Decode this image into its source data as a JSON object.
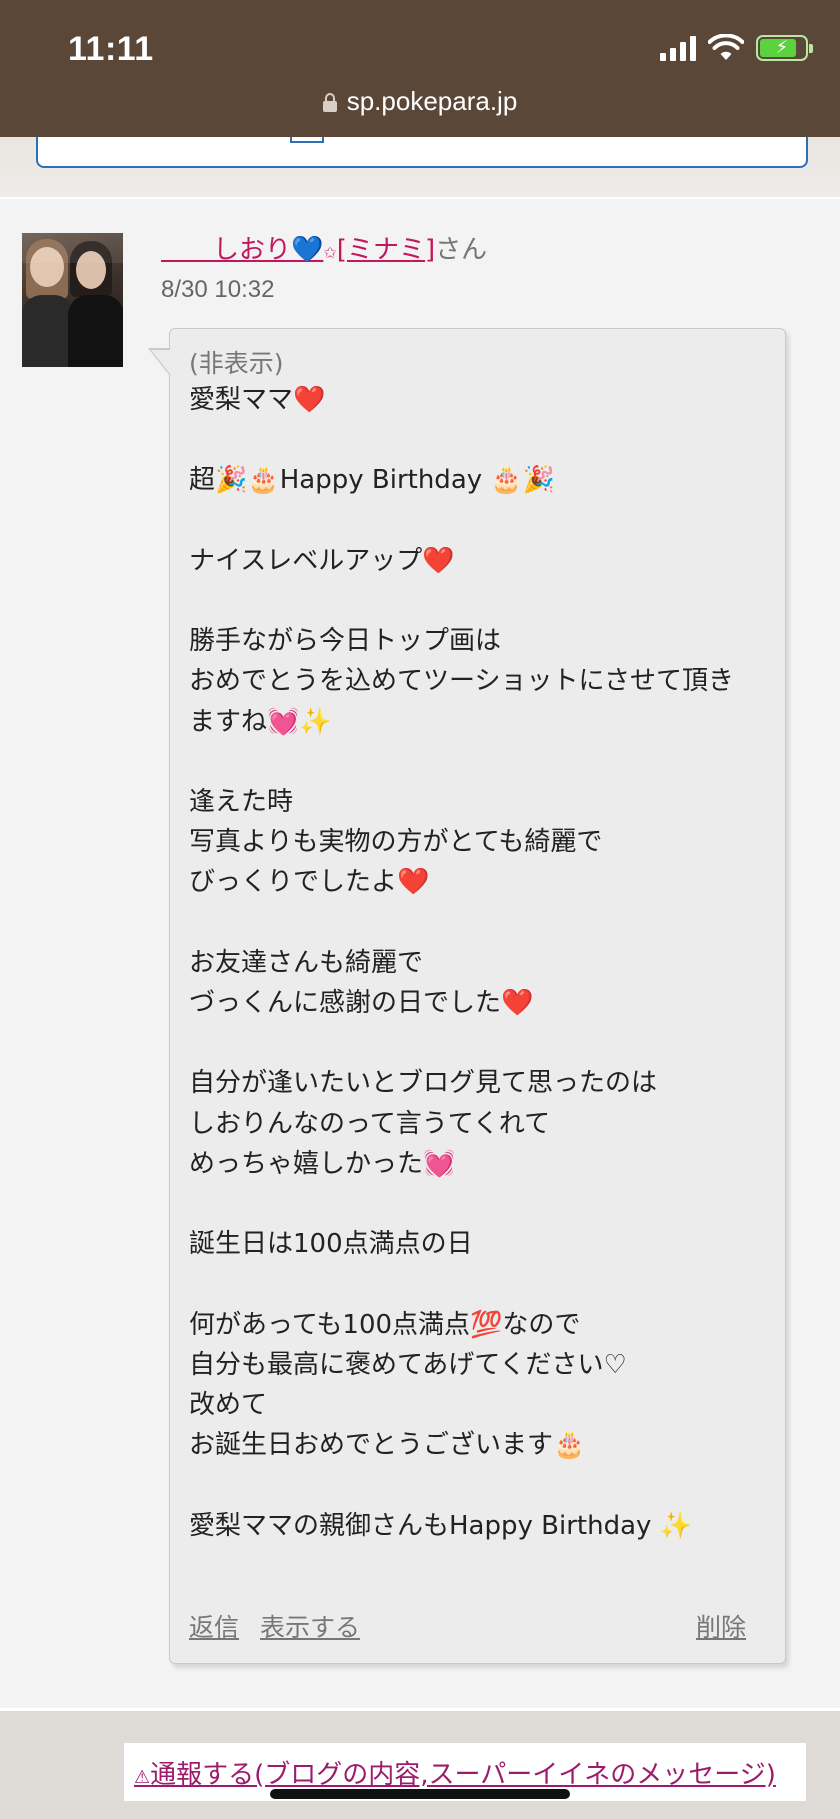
{
  "status_bar": {
    "time": "11:11",
    "url": "sp.pokepara.jp"
  },
  "comment": {
    "author_name": "＿＿しおり",
    "author_tag": "[ミナミ]",
    "author_suffix": "さん",
    "date": "8/30 10:32",
    "hidden_label": "(非表示)",
    "message": "愛梨ママ❤️\n\n超🎉🎂Happy Birthday 🎂🎉\n\nナイスレベルアップ❤️\n\n勝手ながら今日トップ画は\nおめでとうを込めてツーショットにさせて頂き\nますね💓✨\n\n逢えた時\n写真よりも実物の方がとても綺麗で\nびっくりでしたよ❤️\n\nお友達さんも綺麗で\nづっくんに感謝の日でした❤️\n\n自分が逢いたいとブログ見て思ったのは\nしおりんなのって言うてくれて\nめっちゃ嬉しかった💓\n\n誕生日は100点満点の日\n\n何があっても100点満点💯なので\n自分も最高に褒めてあげてください♡\n改めて\nお誕生日おめでとうございます🎂\n\n愛梨ママの親御さんもHappy Birthday ✨",
    "actions": {
      "reply": "返信",
      "show": "表示する",
      "delete": "削除"
    }
  },
  "report_link": "通報する(ブログの内容,スーパーイイネのメッセージ)",
  "colors": {
    "status_bar_bg": "#5a4738",
    "link_pink": "#c2185b",
    "report_link": "#9c1c6b"
  }
}
